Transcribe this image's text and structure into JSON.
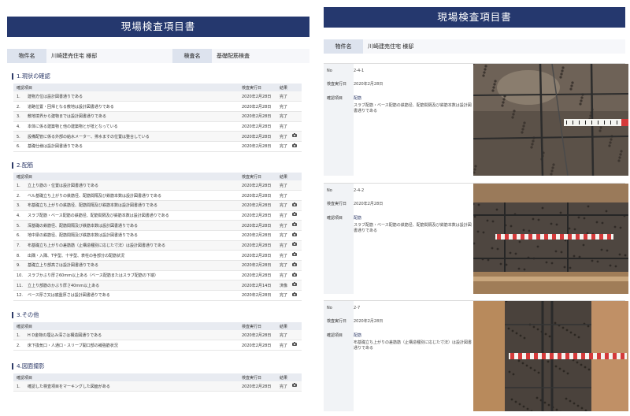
{
  "left": {
    "title": "現場検査項目書",
    "property_label": "物件名",
    "property_value": "川崎建売住宅 様邸",
    "inspection_label": "検査名",
    "inspection_value": "基礎配筋検査",
    "columns": {
      "item": "確認項目",
      "date": "検査実行日",
      "result": "結果"
    },
    "sections": [
      {
        "title": "1.現状の確認",
        "rows": [
          {
            "no": "1.",
            "text": "建物方位は設計図書通りである",
            "date": "2020年2月28日",
            "result": "完了",
            "cam": false
          },
          {
            "no": "2.",
            "text": "道路位置・回帰となる敷地は設計図書通りである",
            "date": "2020年2月28日",
            "result": "完了",
            "cam": false
          },
          {
            "no": "3.",
            "text": "敷地境界から建物までは設計図書通りである",
            "date": "2020年2月28日",
            "result": "完了",
            "cam": false
          },
          {
            "no": "4.",
            "text": "本体に係る建築物と他の建築物とが抵となっている",
            "date": "2020年2月28日",
            "result": "完了",
            "cam": false
          },
          {
            "no": "5.",
            "text": "設備配管に係る外部の給水メーター、排水ますの位置は整合している",
            "date": "2020年2月28日",
            "result": "完了",
            "cam": true
          },
          {
            "no": "6.",
            "text": "基礎仕様は設計図書通りである",
            "date": "2020年2月28日",
            "result": "完了",
            "cam": true
          }
        ]
      },
      {
        "title": "2.配筋",
        "rows": [
          {
            "no": "1.",
            "text": "立上り筋の・位置は設計図書通りである",
            "date": "2020年2月28日",
            "result": "完了",
            "cam": false
          },
          {
            "no": "2.",
            "text": "ベル基礎立ち上がりの鉄筋径、配筋間隔及び鉄筋本数は設計図書通りである",
            "date": "2020年2月28日",
            "result": "完了",
            "cam": false
          },
          {
            "no": "3.",
            "text": "布基礎立ち上がりの鉄筋径、配筋間隔及び鉄筋本数は設計図書通りである",
            "date": "2020年2月28日",
            "result": "完了",
            "cam": true
          },
          {
            "no": "4.",
            "text": "スラブ配筋・ベース配筋の鉄筋径、配筋間隔及び鉄筋本数は設計図書通りである",
            "date": "2020年2月28日",
            "result": "完了",
            "cam": true
          },
          {
            "no": "5.",
            "text": "深基礎の鉄筋径、配筋間隔及び鉄筋本数は設計図書通りである",
            "date": "2020年2月28日",
            "result": "完了",
            "cam": true
          },
          {
            "no": "6.",
            "text": "地中梁の鉄筋径、配筋間隔及び鉄筋本数は設計図書通りである",
            "date": "2020年2月28日",
            "result": "完了",
            "cam": true
          },
          {
            "no": "7.",
            "text": "布基礎立ち上がりの差筋筋（止構造種別に応じた寸法）は設計図書通りである",
            "date": "2020年2月28日",
            "result": "完了",
            "cam": true
          },
          {
            "no": "8.",
            "text": "出隅・入隅、T字型、十字型、表柱の各部分の配筋状況",
            "date": "2020年2月28日",
            "result": "完了",
            "cam": true
          },
          {
            "no": "9.",
            "text": "基礎立上り部高さは設計図書通りである",
            "date": "2020年2月28日",
            "result": "完了",
            "cam": true
          },
          {
            "no": "10.",
            "text": "スラブかぶり厚さ60mm以上ある（ベース配筋またはスラブ配筋の下端）",
            "date": "2020年2月28日",
            "result": "完了",
            "cam": true
          },
          {
            "no": "11.",
            "text": "立上り部筋のかぶり厚さ40mm以上ある",
            "date": "2020年2月14日",
            "result": "済像",
            "cam": true
          },
          {
            "no": "12.",
            "text": "ベース厚さ又は底盤厚さは設計図書通りである",
            "date": "2020年2月28日",
            "result": "完了",
            "cam": true
          }
        ]
      },
      {
        "title": "3.その他",
        "rows": [
          {
            "no": "1.",
            "text": "H D金物の埋込み深さは構造図通りである",
            "date": "2020年2月28日",
            "result": "完了",
            "cam": false
          },
          {
            "no": "2.",
            "text": "床下換気口・人通口・スリーブ開口部の補強筋状況",
            "date": "2020年2月28日",
            "result": "完了",
            "cam": true
          }
        ]
      },
      {
        "title": "4.図面撮影",
        "rows": [
          {
            "no": "1.",
            "text": "確認した検査項目をマーキングした図面がある",
            "date": "2020年2月28日",
            "result": "完了",
            "cam": true
          }
        ]
      }
    ]
  },
  "right": {
    "title": "現場検査項目書",
    "property_label": "物件名",
    "property_value": "川崎建売住宅 様邸",
    "field_labels": {
      "no": "No",
      "date": "検査実行日",
      "item": "確認項目"
    },
    "blocks": [
      {
        "no": "2-4-1",
        "date": "2020年2月28日",
        "category": "配筋",
        "text": "スラブ配筋・ベース配筋の鉄筋径、配筋間隔及び鉄筋本数は設計図書通りである",
        "photo": "rebar-mesh-with-ruler"
      },
      {
        "no": "2-4-2",
        "date": "2020年2月28日",
        "category": "配筋",
        "text": "スラブ配筋・ベース配筋の鉄筋径、配筋間隔及び鉄筋本数は設計図書通りである",
        "photo": "rebar-mesh-with-ruler"
      },
      {
        "no": "2-7",
        "date": "2020年2月28日",
        "category": "配筋",
        "text": "布基礎立ち上がりの差筋筋（止構造種別に応じた寸法）は設計図書通りである",
        "photo": "rebar-column-with-ruler"
      }
    ]
  }
}
